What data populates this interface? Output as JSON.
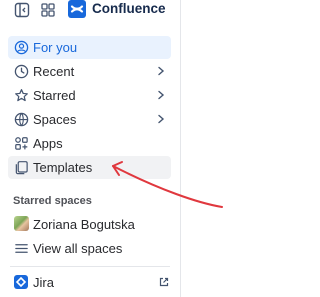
{
  "header": {
    "brand": "Confluence",
    "icons": [
      "sidebar-toggle-icon",
      "app-switcher-icon",
      "confluence-logo-icon"
    ]
  },
  "nav": {
    "items": [
      {
        "label": "For you",
        "icon": "user-circle-icon",
        "state": "active"
      },
      {
        "label": "Recent",
        "icon": "clock-icon",
        "chevron": true
      },
      {
        "label": "Starred",
        "icon": "star-icon",
        "chevron": true
      },
      {
        "label": "Spaces",
        "icon": "spaces-icon",
        "chevron": true
      },
      {
        "label": "Apps",
        "icon": "apps-icon"
      },
      {
        "label": "Templates",
        "icon": "templates-icon",
        "state": "hover"
      }
    ]
  },
  "starred_spaces": {
    "title": "Starred spaces",
    "items": [
      {
        "label": "Zoriana Bogutska",
        "icon": "space-avatar"
      },
      {
        "label": "View all spaces",
        "icon": "list-icon"
      }
    ]
  },
  "apps": {
    "items": [
      {
        "label": "Jira",
        "icon": "jira-logo-icon",
        "external": true
      }
    ]
  },
  "colors": {
    "accent": "#1868db",
    "active_bg": "#e9f2fe",
    "hover_bg": "#f1f2f4",
    "annotation": "#e0383e"
  },
  "annotation": {
    "type": "hand-drawn-arrow",
    "points_to": "Templates"
  }
}
